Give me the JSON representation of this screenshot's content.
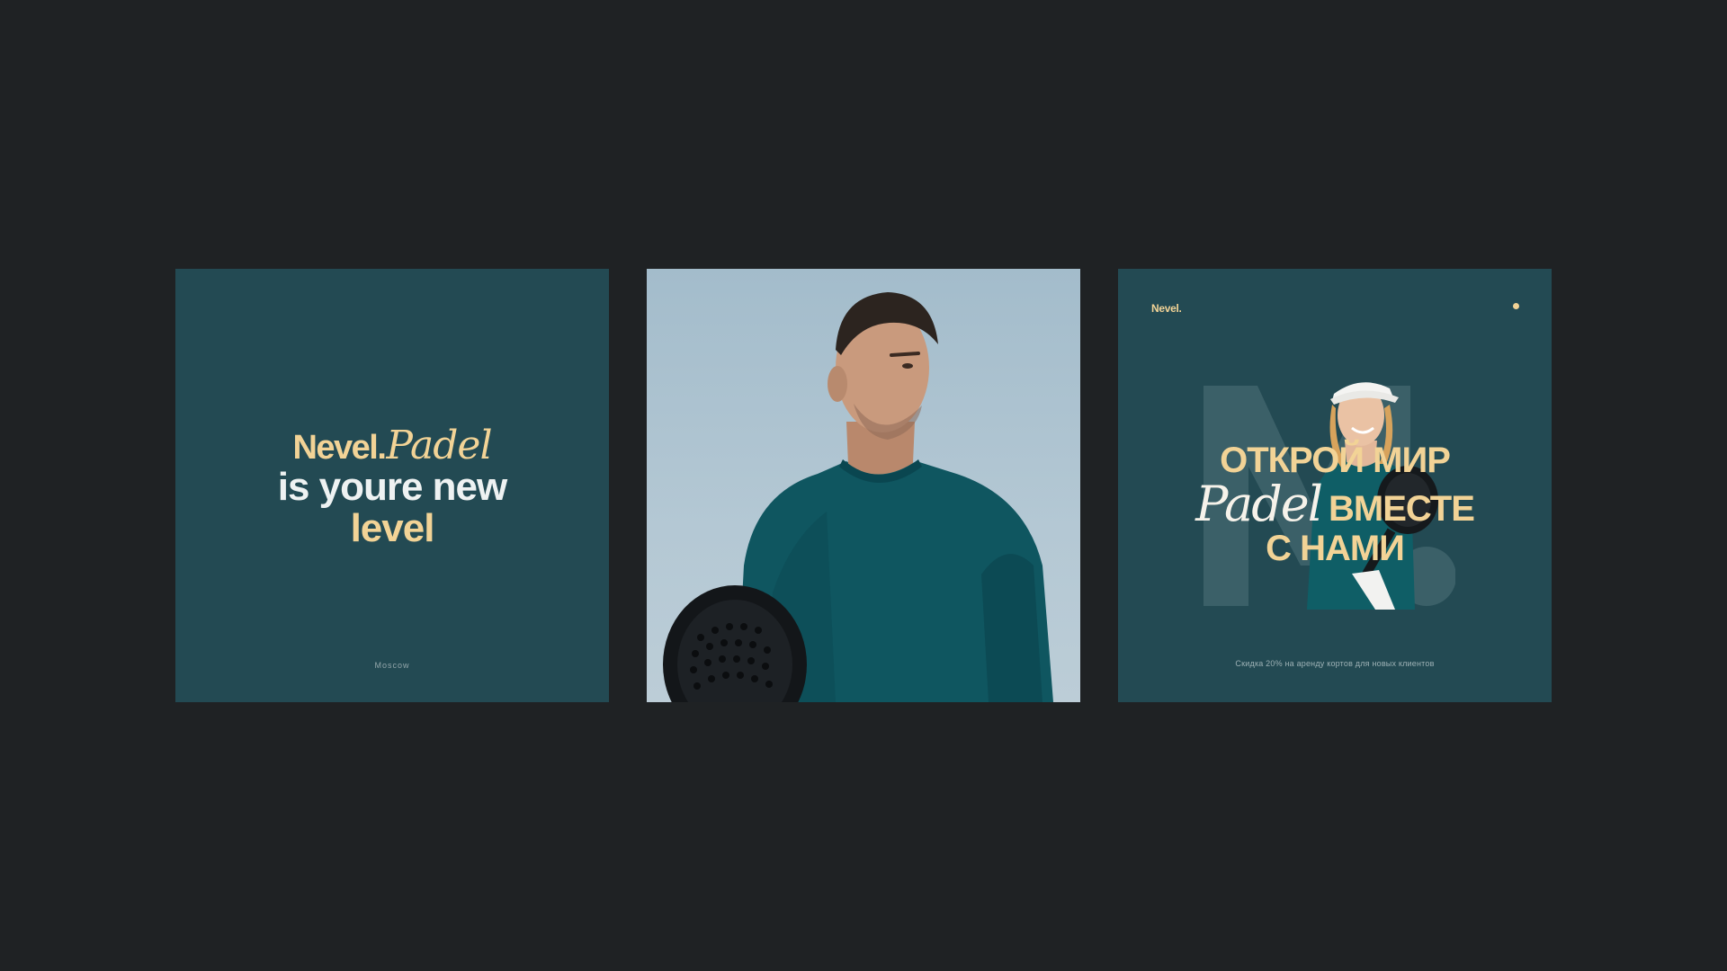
{
  "cards": [
    {
      "brand": "Nevel.",
      "brand_script": "Padel",
      "headline_line2": "is youre new",
      "headline_line3": "level",
      "footer": "Moscow"
    },
    {
      "photo": "man-with-padel-racket-icon"
    },
    {
      "logo": "Nevel.",
      "line1": "ОТКРОЙ МИР",
      "line2_script": "Padel",
      "line2": "ВМЕСТЕ",
      "line3": "С НАМИ",
      "footer": "Скидка 20% на аренду кортов для новых клиентов"
    }
  ],
  "colors": {
    "background": "#1f2224",
    "card_teal": "#234a53",
    "accent_gold": "#f2d396",
    "text_light": "#eef2f2"
  }
}
